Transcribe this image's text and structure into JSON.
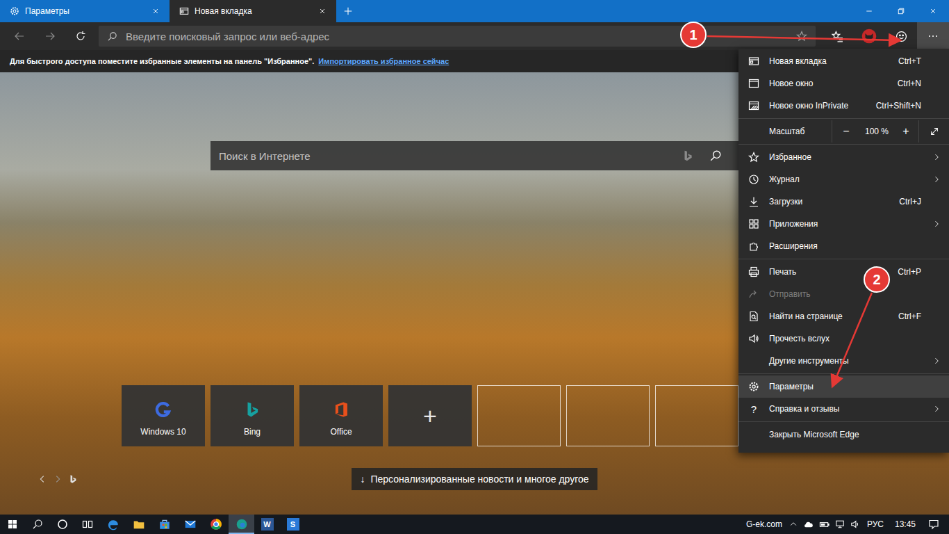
{
  "tabs": [
    {
      "label": "Параметры",
      "selected": false
    },
    {
      "label": "Новая вкладка",
      "selected": true
    }
  ],
  "address_bar": {
    "placeholder": "Введите поисковый запрос или веб-адрес"
  },
  "settings_menu_button": {
    "open": true
  },
  "favorites_bar": {
    "text": "Для быстрого доступа поместите избранные элементы на панель \"Избранное\".",
    "link": "Импортировать избранное сейчас"
  },
  "new_tab_page": {
    "search_placeholder": "Поиск в Интернете",
    "tiles": [
      {
        "kind": "windows",
        "label": "Windows 10"
      },
      {
        "kind": "bing",
        "label": "Bing"
      },
      {
        "kind": "office",
        "label": "Office"
      },
      {
        "kind": "add",
        "glyph": "+"
      },
      {
        "kind": "empty"
      },
      {
        "kind": "empty"
      },
      {
        "kind": "empty"
      }
    ],
    "news_button": {
      "icon": "↓",
      "label": "Персонализированные новости и многое другое"
    }
  },
  "menu": {
    "groups": [
      [
        {
          "kind": "command",
          "label": "Новая вкладка",
          "shortcut": "Ctrl+T",
          "submenu": false,
          "disabled": false,
          "selected": false
        },
        {
          "kind": "command",
          "label": "Новое окно",
          "shortcut": "Ctrl+N",
          "submenu": false,
          "disabled": false,
          "selected": false
        },
        {
          "kind": "command",
          "label": "Новое окно InPrivate",
          "shortcut": "Ctrl+Shift+N",
          "submenu": false,
          "disabled": false,
          "selected": false
        }
      ],
      [
        {
          "kind": "zoom",
          "label": "Масштаб",
          "value": "100 %",
          "decrease": "−",
          "increase": "+"
        }
      ],
      [
        {
          "kind": "command",
          "label": "Избранное",
          "submenu": true,
          "disabled": false,
          "selected": false
        },
        {
          "kind": "command",
          "label": "Журнал",
          "submenu": true,
          "disabled": false,
          "selected": false
        },
        {
          "kind": "command",
          "label": "Загрузки",
          "shortcut": "Ctrl+J",
          "submenu": false,
          "disabled": false,
          "selected": false
        },
        {
          "kind": "command",
          "label": "Приложения",
          "submenu": true,
          "disabled": false,
          "selected": false
        },
        {
          "kind": "command",
          "label": "Расширения",
          "submenu": false,
          "disabled": false,
          "selected": false
        }
      ],
      [
        {
          "kind": "command",
          "label": "Печать",
          "shortcut": "Ctrl+P",
          "submenu": false,
          "disabled": false,
          "selected": false
        },
        {
          "kind": "command",
          "label": "Отправить",
          "submenu": false,
          "disabled": true,
          "selected": false
        },
        {
          "kind": "command",
          "label": "Найти на странице",
          "shortcut": "Ctrl+F",
          "submenu": false,
          "disabled": false,
          "selected": false
        },
        {
          "kind": "command",
          "label": "Прочесть вслух",
          "submenu": false,
          "disabled": false,
          "selected": false
        },
        {
          "kind": "command",
          "label": "Другие инструменты",
          "submenu": true,
          "disabled": false,
          "selected": false
        }
      ],
      [
        {
          "kind": "command",
          "label": "Параметры",
          "submenu": false,
          "disabled": false,
          "selected": true
        },
        {
          "kind": "command",
          "label": "Справка и отзывы",
          "glyph": "?",
          "submenu": true,
          "disabled": false,
          "selected": false
        }
      ],
      [
        {
          "kind": "command",
          "label": "Закрыть Microsoft Edge",
          "submenu": false,
          "disabled": false,
          "selected": false
        }
      ]
    ]
  },
  "annotations": [
    {
      "label": "1"
    },
    {
      "label": "2"
    }
  ],
  "taskbar": {
    "apps": [
      {
        "kind": "edge",
        "selected": false
      },
      {
        "kind": "explorer",
        "selected": false
      },
      {
        "kind": "store",
        "selected": false
      },
      {
        "kind": "mail",
        "selected": false
      },
      {
        "kind": "chrome",
        "selected": false
      },
      {
        "kind": "edge-new",
        "selected": true
      },
      {
        "kind": "word",
        "glyph": "W",
        "selected": false
      },
      {
        "kind": "app",
        "glyph": "S",
        "selected": false
      }
    ],
    "tray_label": "G-ek.com",
    "language": "РУС",
    "time": "13:45"
  }
}
